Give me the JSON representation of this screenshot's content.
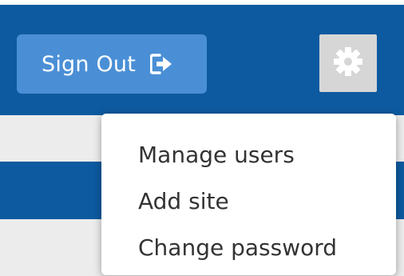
{
  "header": {
    "sign_out_label": "Sign Out",
    "sign_out_icon": "sign-out-icon",
    "settings_icon": "gear-icon"
  },
  "settings_menu": {
    "items": [
      {
        "label": "Manage users"
      },
      {
        "label": "Add site"
      },
      {
        "label": "Change password"
      }
    ]
  },
  "colors": {
    "header_blue": "#0d5aa0",
    "button_blue": "#4a8fd6",
    "gear_button_bg": "#d6d6d6",
    "band_gray": "#ececec",
    "menu_text": "#333333"
  }
}
